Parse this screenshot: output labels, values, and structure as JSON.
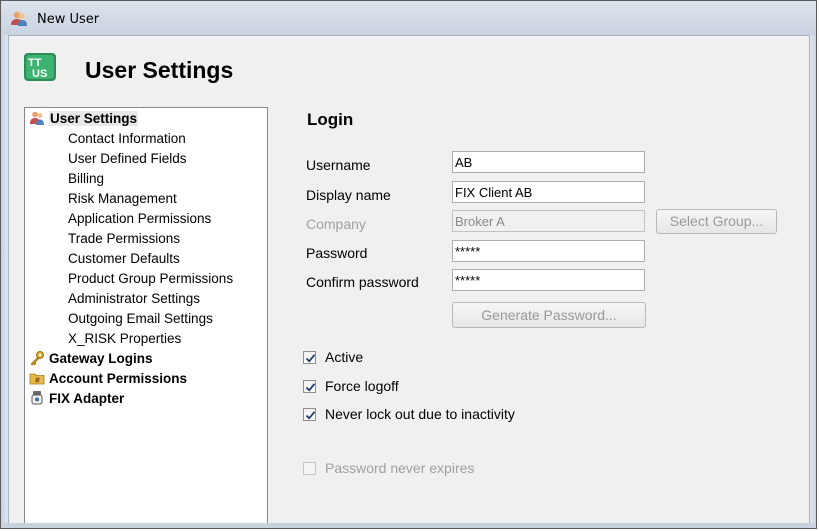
{
  "window": {
    "title": "New User"
  },
  "header": {
    "title": "User Settings",
    "logo_icon": "tt-us-logo-icon"
  },
  "tree": {
    "items": [
      {
        "label": "User Settings",
        "level": 0,
        "icon": "user-group-icon",
        "selected": true
      },
      {
        "label": "Contact Information",
        "level": 1
      },
      {
        "label": "User Defined Fields",
        "level": 1
      },
      {
        "label": "Billing",
        "level": 1
      },
      {
        "label": "Risk Management",
        "level": 1
      },
      {
        "label": "Application Permissions",
        "level": 1
      },
      {
        "label": "Trade Permissions",
        "level": 1
      },
      {
        "label": "Customer Defaults",
        "level": 1
      },
      {
        "label": "Product Group Permissions",
        "level": 1
      },
      {
        "label": "Administrator Settings",
        "level": 1
      },
      {
        "label": "Outgoing Email Settings",
        "level": 1
      },
      {
        "label": "X_RISK Properties",
        "level": 1
      },
      {
        "label": "Gateway Logins",
        "level": 0,
        "icon": "key-icon"
      },
      {
        "label": "Account Permissions",
        "level": 0,
        "icon": "account-folder-icon"
      },
      {
        "label": "FIX Adapter",
        "level": 0,
        "icon": "fix-adapter-icon"
      }
    ]
  },
  "login": {
    "section_title": "Login",
    "username_label": "Username",
    "username_value": "AB",
    "display_name_label": "Display name",
    "display_name_value": "FIX Client AB",
    "company_label": "Company",
    "company_value": "Broker A",
    "select_group_label": "Select Group...",
    "password_label": "Password",
    "password_value": "*****",
    "confirm_password_label": "Confirm password",
    "confirm_password_value": "*****",
    "generate_password_label": "Generate Password..."
  },
  "options": {
    "active": {
      "label": "Active",
      "checked": true
    },
    "force_logoff": {
      "label": "Force logoff",
      "checked": true
    },
    "never_lockout": {
      "label": "Never lock out due to inactivity",
      "checked": true
    },
    "password_never_expires": {
      "label": "Password never expires",
      "checked": false,
      "disabled": true
    }
  }
}
